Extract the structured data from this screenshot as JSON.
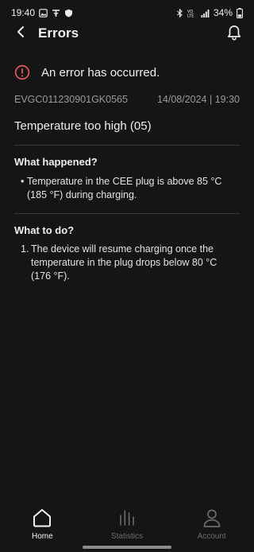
{
  "status_bar": {
    "time": "19:40",
    "battery": "34%",
    "left_icons": [
      "gallery-icon",
      "wifi-calling-icon",
      "shield-icon"
    ],
    "right_icons": [
      "bluetooth-icon",
      "volte-icon",
      "signal-icon",
      "battery-icon"
    ]
  },
  "header": {
    "title": "Errors",
    "back_icon": "chevron-left-icon",
    "notification_icon": "bell-icon"
  },
  "error": {
    "banner_text": "An error has occurred.",
    "banner_icon": "alert-circle-icon",
    "accent_color": "#e0555a",
    "device_id": "EVGC011230901GK0565",
    "datetime": "14/08/2024 | 19:30",
    "title": "Temperature too high (05)"
  },
  "what_happened": {
    "heading": "What happened?",
    "bullets": [
      "Temperature in the CEE plug is above 85 °C (185 °F) during charging."
    ]
  },
  "what_to_do": {
    "heading": "What to do?",
    "steps": [
      "The device will resume charging once the temperature in the plug drops below 80 °C (176 °F)."
    ]
  },
  "nav": {
    "items": [
      {
        "label": "Home",
        "icon": "home-icon",
        "active": true
      },
      {
        "label": "Statistics",
        "icon": "statistics-icon",
        "active": false
      },
      {
        "label": "Account",
        "icon": "account-icon",
        "active": false
      }
    ]
  }
}
